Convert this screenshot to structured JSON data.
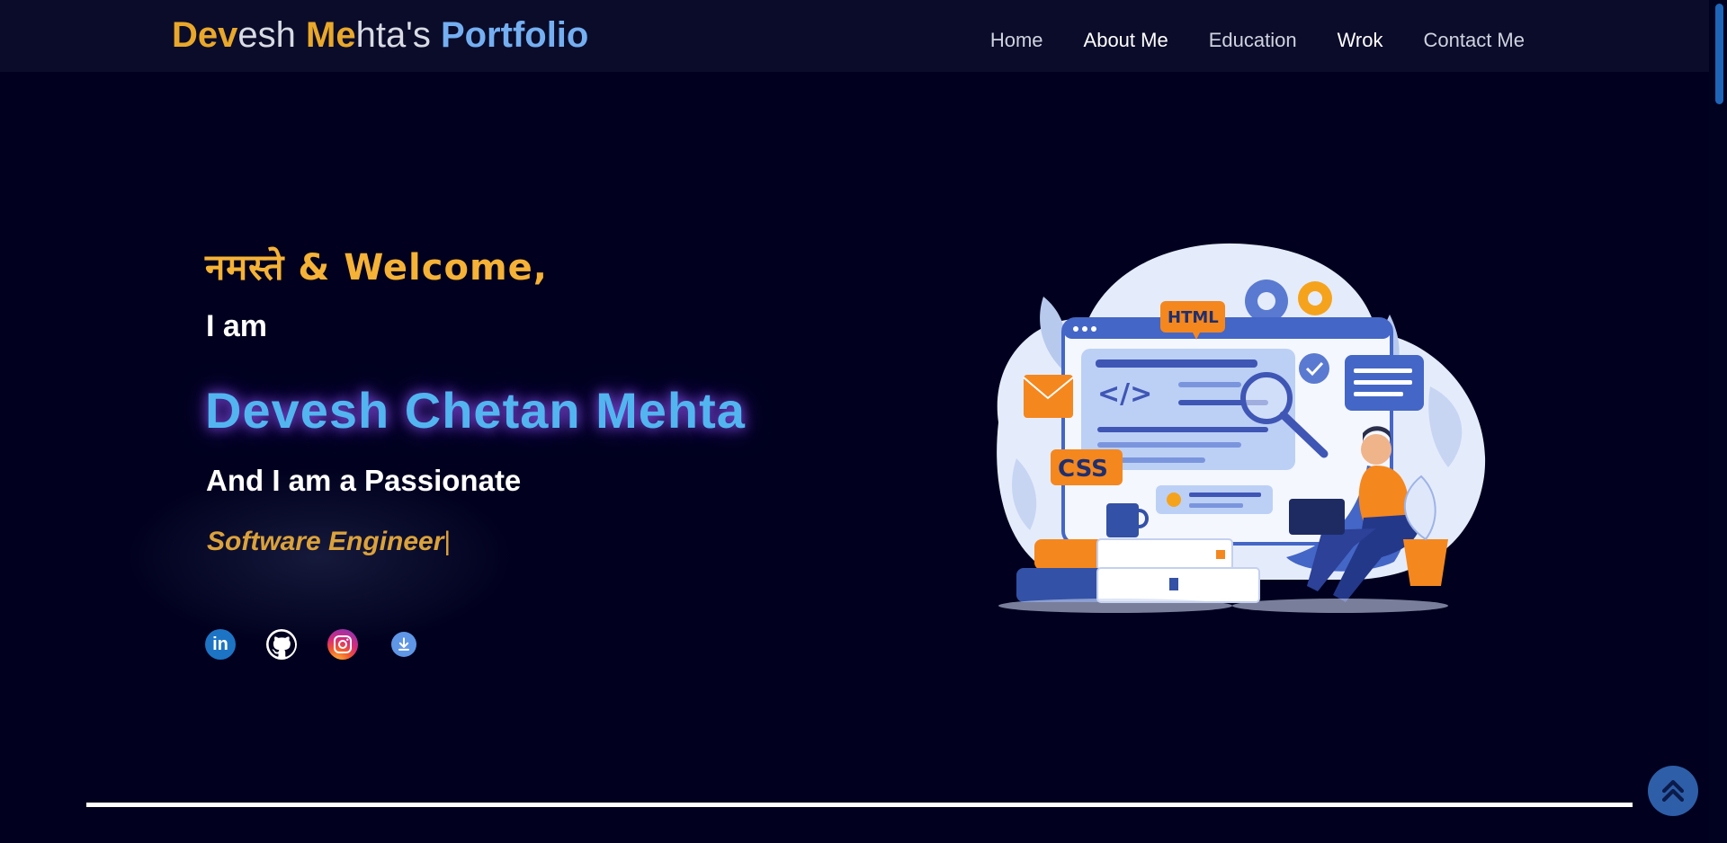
{
  "brand": {
    "part1_gold": "Dev",
    "part2_light": "esh ",
    "part3_gold": "Me",
    "part4_light": "hta's ",
    "part5_blue": "Portfolio"
  },
  "nav": {
    "items": [
      "Home",
      "About Me",
      "Education",
      "Wrok",
      "Contact Me"
    ]
  },
  "hero": {
    "greeting": "नमस्ते & Welcome,",
    "intro": "I am",
    "name": "Devesh Chetan Mehta",
    "passion": "And I am a Passionate",
    "role": "Software Engineer",
    "cursor": "|"
  },
  "illustration": {
    "html_label": "HTML",
    "css_label": "CSS",
    "code_label": "</>"
  },
  "socials": {
    "linkedin_text": "in"
  },
  "colors": {
    "background": "#01011f",
    "navbar": "#0a0c2a",
    "gold": "#e9a82a",
    "blue": "#52b5f0",
    "role": "#dba23b"
  },
  "icons": [
    "linkedin-icon",
    "github-icon",
    "instagram-icon",
    "download-icon",
    "double-chevron-up-icon"
  ]
}
